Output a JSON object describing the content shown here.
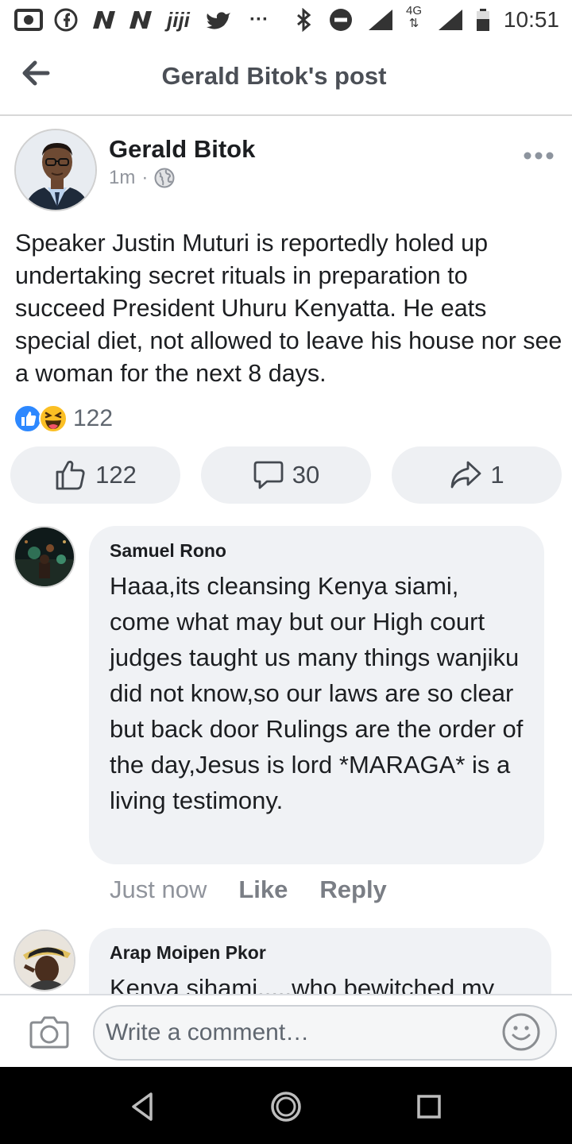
{
  "status_bar": {
    "time": "10:51",
    "network": "4G",
    "icons": [
      "gallery-notification-icon",
      "facebook-notification-icon",
      "n-notification-icon",
      "n-notification-icon",
      "jiji-notification-icon",
      "twitter-notification-icon",
      "more-notifications-icon",
      "bluetooth-icon",
      "do-not-disturb-icon",
      "signal-icon",
      "4g-icon",
      "signal-icon",
      "battery-icon"
    ],
    "jiji_label": "jiji",
    "more_label": "···"
  },
  "app_bar": {
    "title": "Gerald Bitok's post"
  },
  "post": {
    "author": "Gerald Bitok",
    "time": "1m",
    "separator": "·",
    "privacy_icon": "globe-icon",
    "text": "Speaker Justin Muturi is reportedly holed up undertaking secret rituals in preparation to succeed President Uhuru Kenyatta. He eats special diet, not allowed to leave his house nor see a woman for the next 8 days.",
    "reaction_count": "122",
    "reaction_icons": [
      "like-reaction-icon",
      "haha-reaction-icon"
    ]
  },
  "actions": {
    "like_count": "122",
    "comment_count": "30",
    "share_count": "1"
  },
  "comments": [
    {
      "name": "Samuel Rono",
      "text": "Haaa,its cleansing Kenya siami, come what may but our High court judges taught us many things wanjiku did not know,so our laws are so clear but back door Rulings are the order of the day,Jesus is lord *MARAGA* is a living testimony.",
      "time": "Just now",
      "like_label": "Like",
      "reply_label": "Reply"
    },
    {
      "name": "Arap Moipen Pkor",
      "text": "Kenya sihami.....who bewitched my"
    }
  ],
  "composer": {
    "placeholder": "Write a comment…"
  },
  "colors": {
    "facebook_blue": "#1877f2",
    "bubble_bg": "#f0f2f5",
    "muted_text": "#90949c"
  }
}
